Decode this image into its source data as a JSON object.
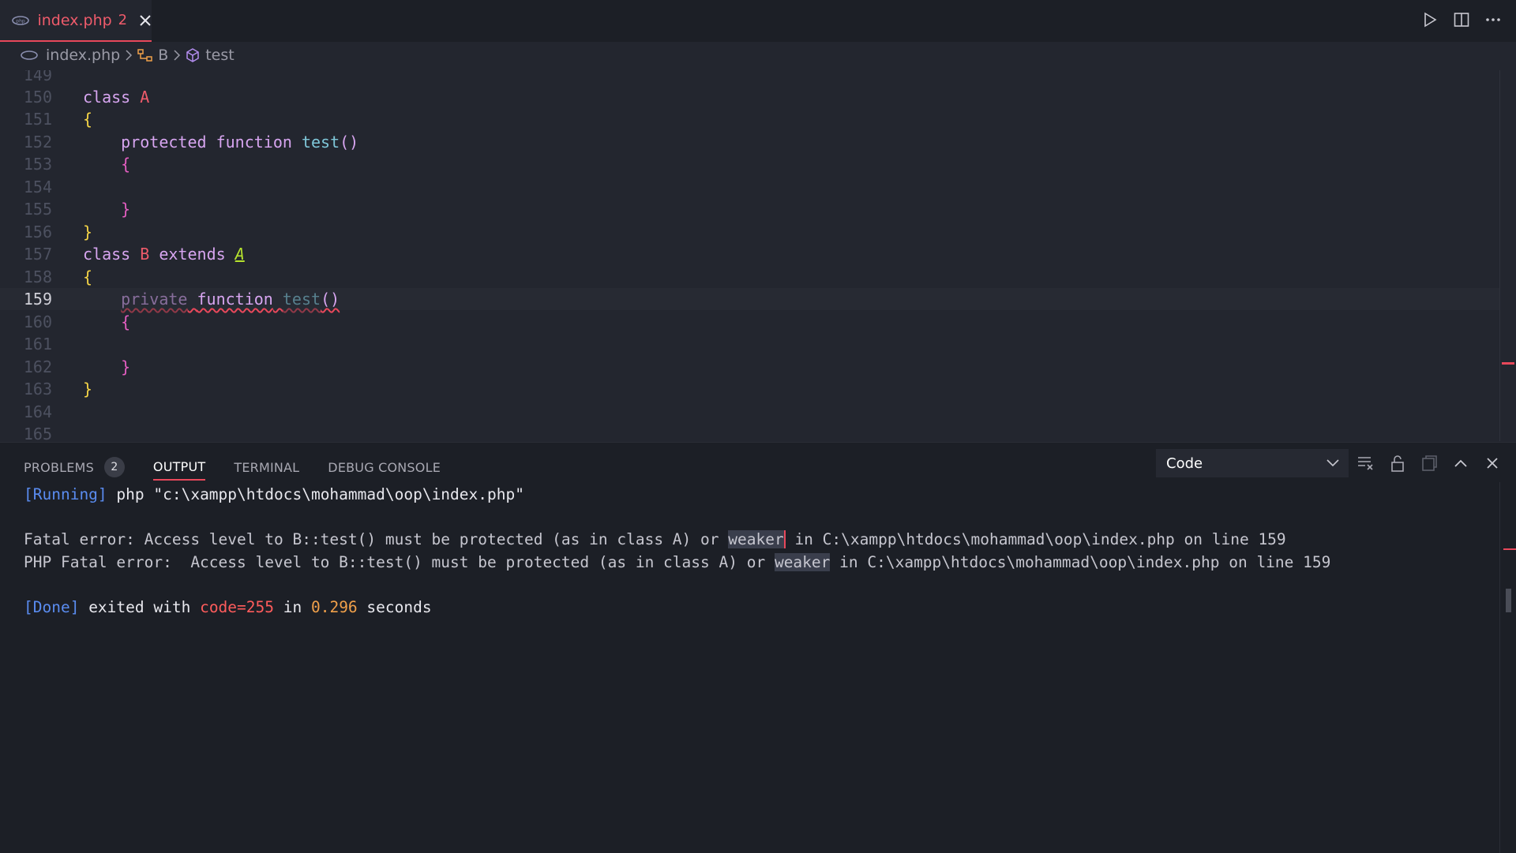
{
  "tab": {
    "filename": "index.php",
    "problem_count": "2"
  },
  "breadcrumb": {
    "file": "index.php",
    "class": "B",
    "method": "test"
  },
  "editor": {
    "lines": [
      {
        "n": "149"
      },
      {
        "n": "150"
      },
      {
        "n": "151"
      },
      {
        "n": "152"
      },
      {
        "n": "153"
      },
      {
        "n": "154"
      },
      {
        "n": "155"
      },
      {
        "n": "156"
      },
      {
        "n": "157"
      },
      {
        "n": "158"
      },
      {
        "n": "159"
      },
      {
        "n": "160"
      },
      {
        "n": "161"
      },
      {
        "n": "162"
      },
      {
        "n": "163"
      },
      {
        "n": "164"
      },
      {
        "n": "165"
      }
    ],
    "tokens": {
      "class": "class",
      "A": "A",
      "B": "B",
      "extends": "extends",
      "protected": "protected",
      "private": "private",
      "function": "function",
      "test": "test",
      "parens": "()",
      "open": "{",
      "close": "}"
    }
  },
  "panel": {
    "tabs": {
      "problems": "PROBLEMS",
      "problems_count": "2",
      "output": "OUTPUT",
      "terminal": "TERMINAL",
      "debug": "DEBUG CONSOLE"
    },
    "channel": "Code",
    "output": {
      "running_tag": "[Running]",
      "running_cmd": " php \"c:\\xampp\\htdocs\\mohammad\\oop\\index.php\"",
      "err1_a": "Fatal error: Access level to B::test() must be protected (as in class A) or ",
      "err1_hl": "weaker",
      "err1_b": " in C:\\xampp\\htdocs\\mohammad\\oop\\index.php on line 159",
      "err2_a": "PHP Fatal error:  Access level to B::test() must be protected (as in class A) or ",
      "err2_hl": "weaker",
      "err2_b": " in C:\\xampp\\htdocs\\mohammad\\oop\\index.php on line 159",
      "done_tag": "[Done]",
      "done_1": " exited with ",
      "done_code": "code=255",
      "done_2": " in ",
      "done_time": "0.296",
      "done_3": " seconds"
    }
  },
  "colors": {
    "accent": "#e8485b",
    "keyword": "#d7a5f0",
    "class": "#ef5b6b",
    "function": "#7fc7d9"
  }
}
